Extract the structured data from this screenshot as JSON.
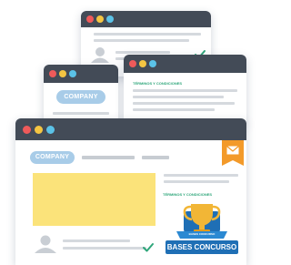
{
  "windows": {
    "top": {
      "controls": [
        "close",
        "minimize",
        "maximize"
      ]
    },
    "middle_left": {
      "company_label": "COMPANY"
    },
    "middle_right": {
      "heading": "TÉRMINOS Y CONDICIONES"
    },
    "front": {
      "company_label": "COMPANY",
      "heading": "TÉRMINOS Y CONDICIONES",
      "badge_title": "BASES CONCURSO",
      "badge_subtitle": "BASES CONCURSO"
    }
  },
  "colors": {
    "titlebar": "#434b57",
    "close": "#ef5a5a",
    "minimize": "#f4c542",
    "maximize": "#5bc2e7",
    "accent_orange": "#f39a2a",
    "placeholder_yellow": "#fbe37a",
    "pill_blue": "#a8cce8",
    "badge_blue": "#1f6fb5",
    "check_green": "#2ea67a"
  },
  "icons": {
    "mail": "envelope-icon",
    "trophy": "trophy-icon",
    "avatar": "user-avatar-icon",
    "check": "checkmark-icon"
  }
}
